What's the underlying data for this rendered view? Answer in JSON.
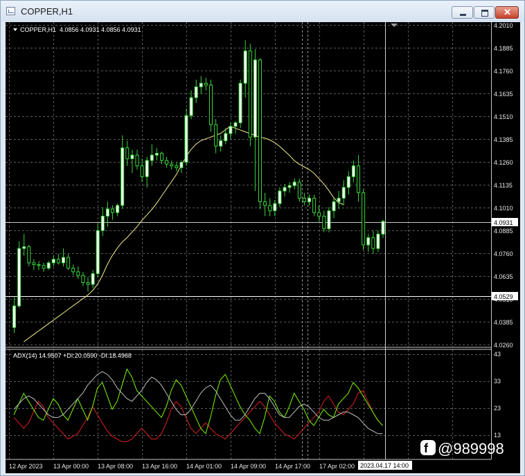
{
  "window": {
    "title": "COPPER,H1",
    "app_icon": "chart-window-icon",
    "buttons": {
      "minimize": "minimize-icon",
      "maximize": "maximize-icon",
      "close": "close-icon"
    }
  },
  "colors": {
    "background": "#000000",
    "grid": "#5a5a5a",
    "axis": "#c8c8c8",
    "bull_candle": "#ffffff",
    "bear_candle": "#000000",
    "candle_outline": "#39d639",
    "moving_average": "#f5f08a",
    "adx_line": "#c0c0c0",
    "plus_di": "#7cfc00",
    "minus_di": "#e02020",
    "current_price_box": "#ffffff"
  },
  "main_panel": {
    "symbol_line": "COPPER,H1  4.0856 4.0931 4.0856 4.0931",
    "collapse_icon": "triangle-down-icon",
    "price_ticks": [
      "4.2010",
      "4.1885",
      "4.1760",
      "4.1635",
      "4.1510",
      "4.1385",
      "4.1260",
      "4.1135",
      "4.1010",
      "4.0885",
      "4.0760",
      "4.0635",
      "4.0510",
      "4.0385",
      "4.0260"
    ],
    "current_price_label": "4.0931",
    "level_label": "4.0529",
    "shift_marker_icon": "chart-shift-icon"
  },
  "indicator_panel": {
    "label": "ADX(14) 14.9507 +DI:20.0590 -DI:18.4968",
    "ticks": [
      "43",
      "33",
      "23",
      "13"
    ]
  },
  "time_axis": {
    "labels": [
      "12 Apr 2023",
      "13 Apr 00:00",
      "13 Apr 08:00",
      "13 Apr 16:00",
      "14 Apr 01:00",
      "14 Apr 09:00",
      "14 Apr 17:00",
      "17 Apr 02:00"
    ],
    "crosshair_label": "2023.04.17 14:00"
  },
  "watermark": {
    "icon": "facebook-logo-icon",
    "text": "@989998"
  },
  "chart_data": {
    "type": "candlestick",
    "ylim": [
      4.0245,
      4.2025
    ],
    "candles": [
      [
        4.034,
        4.051,
        4.031,
        4.046
      ],
      [
        4.046,
        4.082,
        4.045,
        4.078
      ],
      [
        4.078,
        4.086,
        4.074,
        4.079
      ],
      [
        4.079,
        4.08,
        4.068,
        4.07
      ],
      [
        4.07,
        4.072,
        4.066,
        4.069
      ],
      [
        4.069,
        4.071,
        4.066,
        4.0685
      ],
      [
        4.0685,
        4.07,
        4.065,
        4.067
      ],
      [
        4.067,
        4.071,
        4.066,
        4.07
      ],
      [
        4.07,
        4.074,
        4.068,
        4.072
      ],
      [
        4.072,
        4.075,
        4.069,
        4.07
      ],
      [
        4.07,
        4.078,
        4.068,
        4.073
      ],
      [
        4.073,
        4.075,
        4.066,
        4.067
      ],
      [
        4.067,
        4.069,
        4.063,
        4.065
      ],
      [
        4.065,
        4.068,
        4.061,
        4.063
      ],
      [
        4.063,
        4.065,
        4.057,
        4.059
      ],
      [
        4.059,
        4.062,
        4.054,
        4.058
      ],
      [
        4.058,
        4.066,
        4.056,
        4.064
      ],
      [
        4.064,
        4.092,
        4.062,
        4.088
      ],
      [
        4.088,
        4.101,
        4.085,
        4.096
      ],
      [
        4.096,
        4.104,
        4.09,
        4.1
      ],
      [
        4.1,
        4.102,
        4.094,
        4.098
      ],
      [
        4.098,
        4.103,
        4.096,
        4.102
      ],
      [
        4.102,
        4.141,
        4.1,
        4.134
      ],
      [
        4.134,
        4.138,
        4.124,
        4.128
      ],
      [
        4.128,
        4.133,
        4.12,
        4.13
      ],
      [
        4.13,
        4.133,
        4.122,
        4.124
      ],
      [
        4.124,
        4.128,
        4.115,
        4.118
      ],
      [
        4.118,
        4.129,
        4.112,
        4.127
      ],
      [
        4.127,
        4.136,
        4.124,
        4.13
      ],
      [
        4.13,
        4.134,
        4.127,
        4.131
      ],
      [
        4.131,
        4.132,
        4.125,
        4.127
      ],
      [
        4.127,
        4.129,
        4.123,
        4.125
      ],
      [
        4.125,
        4.127,
        4.122,
        4.124
      ],
      [
        4.124,
        4.126,
        4.121,
        4.123
      ],
      [
        4.123,
        4.127,
        4.12,
        4.126
      ],
      [
        4.126,
        4.156,
        4.124,
        4.152
      ],
      [
        4.152,
        4.166,
        4.15,
        4.162
      ],
      [
        4.162,
        4.172,
        4.159,
        4.168
      ],
      [
        4.168,
        4.174,
        4.164,
        4.17
      ],
      [
        4.17,
        4.173,
        4.166,
        4.169
      ],
      [
        4.169,
        4.172,
        4.143,
        4.147
      ],
      [
        4.147,
        4.15,
        4.131,
        4.135
      ],
      [
        4.135,
        4.141,
        4.132,
        4.138
      ],
      [
        4.138,
        4.145,
        4.136,
        4.142
      ],
      [
        4.142,
        4.148,
        4.139,
        4.146
      ],
      [
        4.146,
        4.149,
        4.142,
        4.148
      ],
      [
        4.148,
        4.172,
        4.145,
        4.17
      ],
      [
        4.17,
        4.194,
        4.162,
        4.188
      ],
      [
        4.188,
        4.192,
        4.135,
        4.14
      ],
      [
        4.14,
        4.189,
        4.11,
        4.183
      ],
      [
        4.183,
        4.184,
        4.1,
        4.104
      ],
      [
        4.104,
        4.109,
        4.096,
        4.102
      ],
      [
        4.102,
        4.106,
        4.096,
        4.099
      ],
      [
        4.099,
        4.105,
        4.096,
        4.103
      ],
      [
        4.103,
        4.112,
        4.101,
        4.11
      ],
      [
        4.11,
        4.114,
        4.107,
        4.112
      ],
      [
        4.112,
        4.115,
        4.109,
        4.113
      ],
      [
        4.113,
        4.117,
        4.111,
        4.115
      ],
      [
        4.115,
        4.117,
        4.104,
        4.106
      ],
      [
        4.106,
        4.109,
        4.102,
        4.104
      ],
      [
        4.104,
        4.108,
        4.102,
        4.106
      ],
      [
        4.106,
        4.108,
        4.096,
        4.098
      ],
      [
        4.098,
        4.102,
        4.093,
        4.096
      ],
      [
        4.096,
        4.099,
        4.087,
        4.089
      ],
      [
        4.089,
        4.101,
        4.087,
        4.099
      ],
      [
        4.099,
        4.106,
        4.095,
        4.104
      ],
      [
        4.104,
        4.11,
        4.1,
        4.106
      ],
      [
        4.106,
        4.116,
        4.102,
        4.112
      ],
      [
        4.112,
        4.121,
        4.108,
        4.118
      ],
      [
        4.118,
        4.127,
        4.115,
        4.124
      ],
      [
        4.124,
        4.13,
        4.104,
        4.109
      ],
      [
        4.109,
        4.111,
        4.077,
        4.08
      ],
      [
        4.08,
        4.086,
        4.076,
        4.084
      ],
      [
        4.084,
        4.088,
        4.075,
        4.078
      ],
      [
        4.078,
        4.088,
        4.076,
        4.086
      ],
      [
        4.086,
        4.094,
        4.084,
        4.0931
      ]
    ],
    "ma_start": 2,
    "moving_average": [
      4.026,
      4.028,
      4.03,
      4.032,
      4.034,
      4.036,
      4.038,
      4.04,
      4.042,
      4.044,
      4.046,
      4.048,
      4.05,
      4.052,
      4.0545,
      4.058,
      4.063,
      4.069,
      4.074,
      4.078,
      4.0815,
      4.084,
      4.087,
      4.09,
      4.0935,
      4.0965,
      4.0995,
      4.103,
      4.107,
      4.111,
      4.115,
      4.119,
      4.124,
      4.129,
      4.133,
      4.136,
      4.138,
      4.139,
      4.14,
      4.141,
      4.142,
      4.144,
      4.146,
      4.145,
      4.144,
      4.143,
      4.142,
      4.141,
      4.14,
      4.1395,
      4.1385,
      4.137,
      4.135,
      4.1325,
      4.13,
      4.127,
      4.125,
      4.1235,
      4.122,
      4.12,
      4.117,
      4.114,
      4.1105,
      4.1065,
      4.1035,
      4.1025
    ],
    "adx": {
      "ylim": [
        8,
        45
      ],
      "adx": [
        24,
        26,
        28,
        29,
        28,
        26,
        24,
        22,
        21,
        21,
        22,
        24,
        26,
        28,
        30,
        33,
        35,
        37,
        38,
        37,
        35,
        32,
        30,
        28,
        27,
        29,
        31,
        34,
        36,
        35,
        33,
        30,
        27,
        24,
        22,
        22,
        24,
        27,
        30,
        32,
        33,
        31,
        28,
        25,
        22,
        20,
        20,
        22,
        25,
        28,
        30,
        30,
        28,
        25,
        22,
        21,
        21,
        23,
        25,
        26,
        25,
        23,
        21,
        20,
        20,
        21,
        22,
        23,
        23,
        22,
        21,
        19,
        17,
        16,
        15,
        15
      ],
      "plus_di": [
        22,
        26,
        30,
        27,
        24,
        21,
        20,
        24,
        28,
        26,
        22,
        20,
        24,
        28,
        24,
        20,
        25,
        32,
        34,
        29,
        24,
        27,
        33,
        39,
        36,
        31,
        29,
        27,
        25,
        23,
        21,
        25,
        31,
        35,
        33,
        29,
        25,
        21,
        17,
        15,
        21,
        29,
        35,
        37,
        33,
        29,
        25,
        22,
        20,
        17,
        15,
        21,
        29,
        27,
        23,
        21,
        25,
        30,
        27,
        24,
        20,
        18,
        21,
        24,
        22,
        21,
        26,
        28,
        30,
        34,
        32,
        29,
        26,
        23,
        20,
        18
      ],
      "minus_di": [
        21,
        19,
        17,
        19,
        23,
        27,
        25,
        21,
        19,
        17,
        15,
        13,
        14,
        15,
        18,
        21,
        25,
        22,
        19,
        16,
        14,
        13,
        12,
        12,
        13,
        15,
        17,
        15,
        13,
        13,
        15,
        19,
        24,
        27,
        25,
        21,
        17,
        15,
        17,
        19,
        17,
        15,
        14,
        13,
        15,
        17,
        19,
        21,
        23,
        25,
        27,
        25,
        22,
        19,
        17,
        15,
        14,
        13,
        15,
        17,
        19,
        21,
        23,
        27,
        29,
        26,
        23,
        22,
        24,
        26,
        30,
        31,
        27,
        23,
        20,
        18
      ]
    }
  }
}
